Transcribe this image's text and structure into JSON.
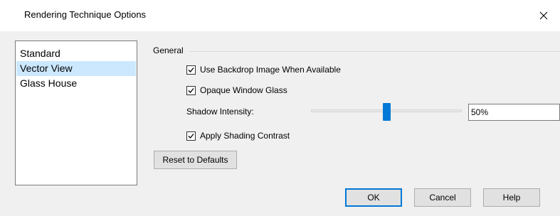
{
  "window": {
    "title": "Rendering Technique Options",
    "close_icon": "close-icon"
  },
  "techniques": {
    "items": [
      {
        "label": "Standard",
        "selected": false
      },
      {
        "label": "Vector View",
        "selected": true
      },
      {
        "label": "Glass House",
        "selected": false
      }
    ]
  },
  "general": {
    "group_label": "General",
    "use_backdrop": {
      "label": "Use Backdrop Image When Available",
      "checked": true
    },
    "opaque_glass": {
      "label": "Opaque Window Glass",
      "checked": true
    },
    "shadow_intensity": {
      "label": "Shadow Intensity:",
      "value": "50%",
      "fraction": 0.5
    },
    "shading_contrast": {
      "label": "Apply Shading Contrast",
      "checked": true
    }
  },
  "buttons": {
    "reset": "Reset to Defaults",
    "ok": "OK",
    "cancel": "Cancel",
    "help": "Help"
  },
  "colors": {
    "accent": "#0078d7",
    "selection": "#cce8ff",
    "dialog_bg": "#f0f0f0"
  }
}
